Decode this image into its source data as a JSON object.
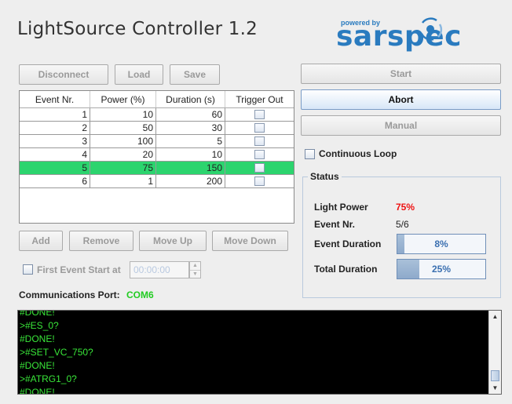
{
  "app": {
    "title": "LightSource Controller 1.2"
  },
  "logo": {
    "powered_by": "powered by",
    "brand": "sarspec"
  },
  "toolbar": {
    "disconnect": "Disconnect",
    "load": "Load",
    "save": "Save"
  },
  "table": {
    "headers": [
      "Event Nr.",
      "Power (%)",
      "Duration (s)",
      "Trigger Out"
    ],
    "rows": [
      {
        "event": "1",
        "power": "10",
        "duration": "60",
        "trigger": false
      },
      {
        "event": "2",
        "power": "50",
        "duration": "30",
        "trigger": false
      },
      {
        "event": "3",
        "power": "100",
        "duration": "5",
        "trigger": false
      },
      {
        "event": "4",
        "power": "20",
        "duration": "10",
        "trigger": false
      },
      {
        "event": "5",
        "power": "75",
        "duration": "150",
        "trigger": false,
        "selected": true
      },
      {
        "event": "6",
        "power": "1",
        "duration": "200",
        "trigger": false
      }
    ]
  },
  "table_actions": {
    "add": "Add",
    "remove": "Remove",
    "move_up": "Move Up",
    "move_down": "Move Down"
  },
  "first_event": {
    "label": "First Event Start at",
    "time_value": "00:00:00"
  },
  "comm": {
    "label": "Communications Port:",
    "port": "COM6"
  },
  "controls": {
    "start": "Start",
    "abort": "Abort",
    "manual": "Manual",
    "continuous_loop": "Continuous Loop"
  },
  "status": {
    "title": "Status",
    "light_power_label": "Light Power",
    "light_power_value": "75%",
    "event_nr_label": "Event Nr.",
    "event_nr_value": "5/6",
    "event_duration_label": "Event Duration",
    "event_duration_value": "8%",
    "event_duration_fraction": 0.08,
    "total_duration_label": "Total Duration",
    "total_duration_value": "25%",
    "total_duration_fraction": 0.25
  },
  "console": {
    "lines": [
      "#DONE!",
      ">#ES_0?",
      "#DONE!",
      ">#SET_VC_750?",
      "#DONE!",
      ">#ATRG1_0?",
      "#DONE!"
    ]
  },
  "colors": {
    "selected_row": "#2cd46e",
    "port_text": "#22cc22",
    "power_value": "#ee1111",
    "console_text": "#39e639",
    "brand": "#2a7bbf"
  },
  "icons": {
    "logo": "sarspec-swirl-icon",
    "scroll_up": "arrow-up-icon",
    "scroll_down": "arrow-down-icon"
  }
}
